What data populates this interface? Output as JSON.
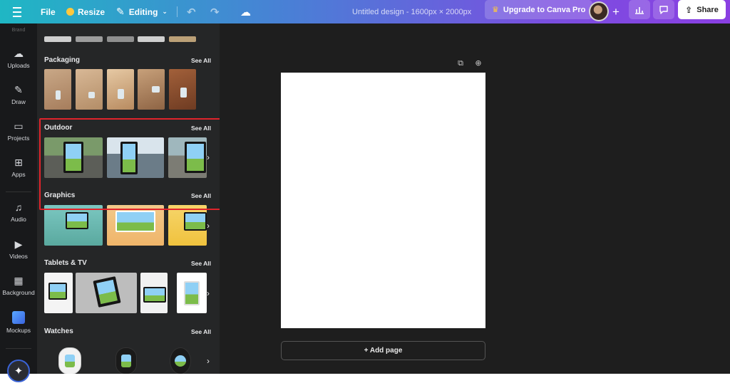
{
  "topbar": {
    "file_label": "File",
    "resize_label": "Resize",
    "editing_label": "Editing",
    "document_title": "Untitled design - 1600px × 2000px",
    "upgrade_label": "Upgrade to Canva Pro",
    "share_label": "Share",
    "plus_glyph": "+",
    "icons": {
      "menu": "hamburger-menu-icon",
      "resize": "crown-dot-icon",
      "edit": "pencil-icon",
      "undo": "undo-icon",
      "redo": "redo-icon",
      "cloud": "cloud-save-icon",
      "upgrade": "crown-icon",
      "stats": "bar-chart-icon",
      "comment": "comment-icon",
      "share": "upload-icon"
    },
    "glyphs": {
      "pen": "✎",
      "chevron": "⌄",
      "undo": "↶",
      "redo": "↷",
      "cloud": "☁",
      "crown": "♛",
      "stats": "▮▮▮",
      "comment": "▢",
      "share": "⇪"
    }
  },
  "rail": {
    "brand_label": "Brand",
    "items": [
      {
        "label": "Uploads",
        "icon": "upload-cloud-icon",
        "glyph": "☁"
      },
      {
        "label": "Draw",
        "icon": "pen-icon",
        "glyph": "✎"
      },
      {
        "label": "Projects",
        "icon": "folder-icon",
        "glyph": "▭"
      },
      {
        "label": "Apps",
        "icon": "apps-grid-icon",
        "glyph": "⊞"
      },
      {
        "label": "Audio",
        "icon": "music-note-icon",
        "glyph": "♫"
      },
      {
        "label": "Videos",
        "icon": "video-play-icon",
        "glyph": "▶"
      },
      {
        "label": "Background",
        "icon": "background-pattern-icon",
        "glyph": "▦"
      },
      {
        "label": "Mockups",
        "icon": "mockups-icon",
        "glyph": ""
      }
    ],
    "magic_glyph": "✦"
  },
  "panel": {
    "sections": [
      {
        "title": "Packaging",
        "see_all": "See All"
      },
      {
        "title": "Outdoor",
        "see_all": "See All"
      },
      {
        "title": "Graphics",
        "see_all": "See All"
      },
      {
        "title": "Tablets & TV",
        "see_all": "See All"
      },
      {
        "title": "Watches",
        "see_all": "See All"
      }
    ],
    "next_glyph": "›"
  },
  "canvas": {
    "add_page_label": "+ Add page",
    "tool_glyphs": {
      "duplicate": "⧉",
      "add": "⊕"
    }
  },
  "colors": {
    "highlight": "#e0242b",
    "share_bg": "#ffffff",
    "panel_bg": "#252627",
    "workspace_bg": "#1e1e1e"
  }
}
